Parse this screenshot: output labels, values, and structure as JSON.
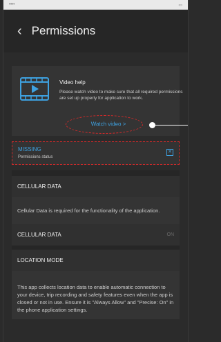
{
  "header": {
    "title": "Permissions"
  },
  "video_help": {
    "title": "Video help",
    "body": "Please watch video to make sure that all required permissions are set up properly for application to work.",
    "link_label": "Watch video >"
  },
  "status": {
    "label": "MISSING",
    "sub": "Permissions status"
  },
  "cellular": {
    "header": "CELLULAR DATA",
    "body": "Cellular Data is required for the functionality of the application.",
    "row_label": "CELLULAR DATA",
    "row_value": "ON"
  },
  "location": {
    "header": "LOCATION MODE",
    "body": "This app collects location data to enable automatic connection to your device, trip recording and safety features even when the app is closed or not in use. Ensure it is \"Always Allow\" and \"Precise: On\" in the phone application settings."
  },
  "colors": {
    "accent": "#3ea1e0",
    "highlight": "#d42a2a",
    "background": "#2b2b2b"
  },
  "icons": {
    "back": "chevron-left-icon",
    "video": "video-play-icon",
    "status": "square-x-icon"
  }
}
